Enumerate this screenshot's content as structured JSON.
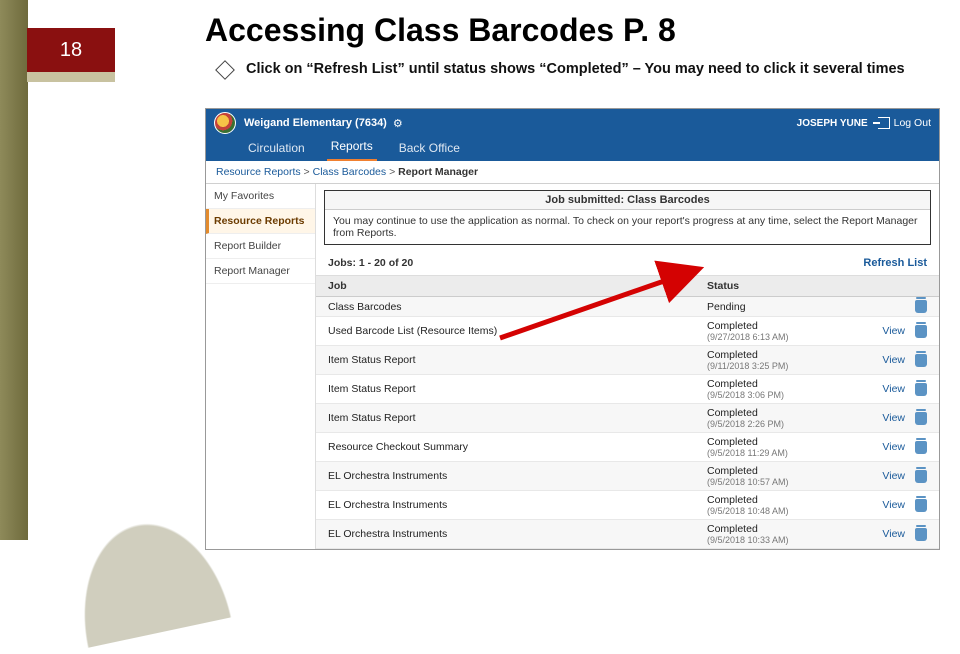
{
  "slide": {
    "number": "18",
    "title": "Accessing Class Barcodes P. 8",
    "bullet": "Click on “Refresh List” until status shows “Completed” – You may need to click it several times"
  },
  "header": {
    "school": "Weigand Elementary (7634)",
    "user": "JOSEPH YUNE",
    "logout": "Log Out"
  },
  "tabs": {
    "circulation": "Circulation",
    "reports": "Reports",
    "back_office": "Back Office"
  },
  "breadcrumbs": {
    "a": "Resource Reports",
    "b": "Class Barcodes",
    "c": "Report Manager",
    "sep": ">"
  },
  "sidebar": {
    "items": [
      {
        "label": "My Favorites"
      },
      {
        "label": "Resource Reports"
      },
      {
        "label": "Report Builder"
      },
      {
        "label": "Report Manager"
      }
    ]
  },
  "notice": {
    "head": "Job submitted: Class Barcodes",
    "body": "You may continue to use the application as normal. To check on your report's progress at any time, select the Report Manager from Reports."
  },
  "jobs": {
    "count": "Jobs: 1 - 20 of 20",
    "refresh": "Refresh List",
    "col_job": "Job",
    "col_status": "Status",
    "view": "View",
    "rows": [
      {
        "name": "Class Barcodes",
        "status": "Pending",
        "ts": "",
        "view": false
      },
      {
        "name": "Used Barcode List (Resource Items)",
        "status": "Completed",
        "ts": "(9/27/2018 6:13 AM)",
        "view": true
      },
      {
        "name": "Item Status Report",
        "status": "Completed",
        "ts": "(9/11/2018 3:25 PM)",
        "view": true
      },
      {
        "name": "Item Status Report",
        "status": "Completed",
        "ts": "(9/5/2018 3:06 PM)",
        "view": true
      },
      {
        "name": "Item Status Report",
        "status": "Completed",
        "ts": "(9/5/2018 2:26 PM)",
        "view": true
      },
      {
        "name": "Resource Checkout Summary",
        "status": "Completed",
        "ts": "(9/5/2018 11:29 AM)",
        "view": true
      },
      {
        "name": "EL Orchestra Instruments",
        "status": "Completed",
        "ts": "(9/5/2018 10:57 AM)",
        "view": true
      },
      {
        "name": "EL Orchestra Instruments",
        "status": "Completed",
        "ts": "(9/5/2018 10:48 AM)",
        "view": true
      },
      {
        "name": "EL Orchestra Instruments",
        "status": "Completed",
        "ts": "(9/5/2018 10:33 AM)",
        "view": true
      }
    ]
  }
}
